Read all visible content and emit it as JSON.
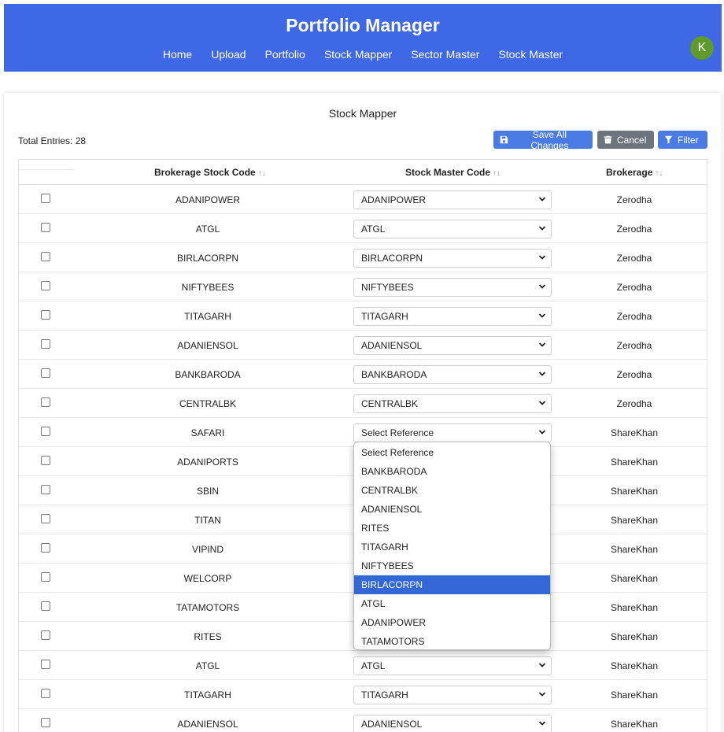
{
  "app": {
    "title": "Portfolio Manager",
    "avatar_initial": "K"
  },
  "nav": [
    "Home",
    "Upload",
    "Portfolio",
    "Stock Mapper",
    "Sector Master",
    "Stock Master"
  ],
  "page": {
    "title": "Stock Mapper",
    "total_entries": "Total Entries: 28"
  },
  "buttons": {
    "save": "Save All Changes",
    "cancel": "Cancel",
    "filter": "Filter"
  },
  "table": {
    "columns": [
      "Brokerage Stock Code",
      "Stock Master Code",
      "Brokerage"
    ],
    "rows": [
      {
        "code": "ADANIPOWER",
        "master": "ADANIPOWER",
        "brokerage": "Zerodha"
      },
      {
        "code": "ATGL",
        "master": "ATGL",
        "brokerage": "Zerodha"
      },
      {
        "code": "BIRLACORPN",
        "master": "BIRLACORPN",
        "brokerage": "Zerodha"
      },
      {
        "code": "NIFTYBEES",
        "master": "NIFTYBEES",
        "brokerage": "Zerodha"
      },
      {
        "code": "TITAGARH",
        "master": "TITAGARH",
        "brokerage": "Zerodha"
      },
      {
        "code": "ADANIENSOL",
        "master": "ADANIENSOL",
        "brokerage": "Zerodha"
      },
      {
        "code": "BANKBARODA",
        "master": "BANKBARODA",
        "brokerage": "Zerodha"
      },
      {
        "code": "CENTRALBK",
        "master": "CENTRALBK",
        "brokerage": "Zerodha"
      },
      {
        "code": "SAFARI",
        "master": "Select Reference",
        "brokerage": "ShareKhan"
      },
      {
        "code": "ADANIPORTS",
        "master": "",
        "brokerage": "ShareKhan"
      },
      {
        "code": "SBIN",
        "master": "",
        "brokerage": "ShareKhan"
      },
      {
        "code": "TITAN",
        "master": "",
        "brokerage": "ShareKhan"
      },
      {
        "code": "VIPIND",
        "master": "",
        "brokerage": "ShareKhan"
      },
      {
        "code": "WELCORP",
        "master": "",
        "brokerage": "ShareKhan"
      },
      {
        "code": "TATAMOTORS",
        "master": "",
        "brokerage": "ShareKhan"
      },
      {
        "code": "RITES",
        "master": "",
        "brokerage": "ShareKhan"
      },
      {
        "code": "ATGL",
        "master": "ATGL",
        "brokerage": "ShareKhan"
      },
      {
        "code": "TITAGARH",
        "master": "TITAGARH",
        "brokerage": "ShareKhan"
      },
      {
        "code": "ADANIENSOL",
        "master": "ADANIENSOL",
        "brokerage": "ShareKhan"
      }
    ]
  },
  "dropdown": {
    "options": [
      "Select Reference",
      "BANKBARODA",
      "CENTRALBK",
      "ADANIENSOL",
      "RITES",
      "TITAGARH",
      "NIFTYBEES",
      "BIRLACORPN",
      "ATGL",
      "ADANIPOWER",
      "TATAMOTORS"
    ],
    "highlighted": "BIRLACORPN"
  },
  "colors": {
    "header": "#3f68e6",
    "primary_button": "#4a7be5",
    "cancel_button": "#6c757d",
    "avatar": "#5f9a2c",
    "highlight": "#3367d6"
  }
}
